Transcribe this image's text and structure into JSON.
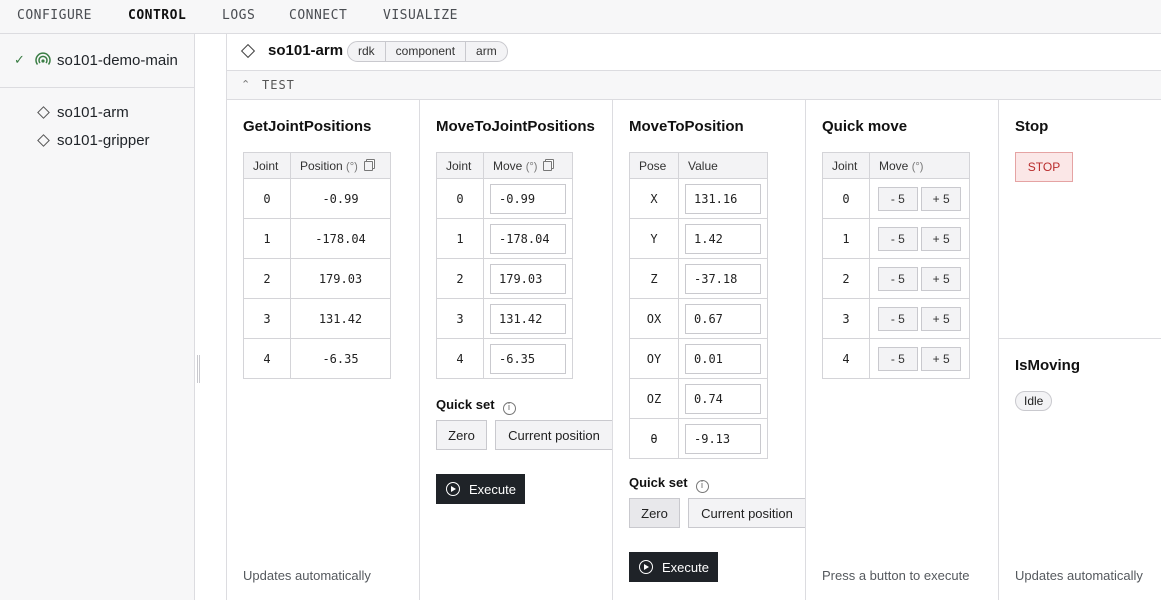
{
  "nav": {
    "tabs": [
      {
        "label": "CONFIGURE"
      },
      {
        "label": "CONTROL"
      },
      {
        "label": "LOGS"
      },
      {
        "label": "CONNECT"
      },
      {
        "label": "VISUALIZE"
      }
    ]
  },
  "sidebar": {
    "machine": {
      "name": "so101-demo-main",
      "status_icon": "checkmark-icon",
      "online_icon": "online-signal-icon"
    },
    "items": [
      {
        "label": "so101-arm"
      },
      {
        "label": "so101-gripper"
      }
    ]
  },
  "card": {
    "title": "so101-arm",
    "breadcrumbs": [
      "rdk",
      "component",
      "arm"
    ],
    "section": "TEST"
  },
  "get_joint_positions": {
    "title": "GetJointPositions",
    "headers": {
      "joint": "Joint",
      "position": "Position",
      "unit": "(°)"
    },
    "rows": [
      {
        "joint": "0",
        "value": "-0.99"
      },
      {
        "joint": "1",
        "value": "-178.04"
      },
      {
        "joint": "2",
        "value": "179.03"
      },
      {
        "joint": "3",
        "value": "131.42"
      },
      {
        "joint": "4",
        "value": "-6.35"
      }
    ],
    "footer": "Updates automatically"
  },
  "move_to_joint_positions": {
    "title": "MoveToJointPositions",
    "headers": {
      "joint": "Joint",
      "move": "Move",
      "unit": "(°)"
    },
    "rows": [
      {
        "joint": "0",
        "value": "-0.99"
      },
      {
        "joint": "1",
        "value": "-178.04"
      },
      {
        "joint": "2",
        "value": "179.03"
      },
      {
        "joint": "3",
        "value": "131.42"
      },
      {
        "joint": "4",
        "value": "-6.35"
      }
    ],
    "quick_set": "Quick set",
    "zero": "Zero",
    "current": "Current position",
    "execute": "Execute"
  },
  "move_to_position": {
    "title": "MoveToPosition",
    "headers": {
      "pose": "Pose",
      "value": "Value"
    },
    "rows": [
      {
        "pose": "X",
        "value": "131.16"
      },
      {
        "pose": "Y",
        "value": "1.42"
      },
      {
        "pose": "Z",
        "value": "-37.18"
      },
      {
        "pose": "OX",
        "value": "0.67"
      },
      {
        "pose": "OY",
        "value": "0.01"
      },
      {
        "pose": "OZ",
        "value": "0.74"
      },
      {
        "pose": "θ",
        "value": "-9.13"
      }
    ],
    "quick_set": "Quick set",
    "zero": "Zero",
    "current": "Current position",
    "execute": "Execute"
  },
  "quick_move": {
    "title": "Quick move",
    "headers": {
      "joint": "Joint",
      "move": "Move",
      "unit": "(°)"
    },
    "rows": [
      {
        "joint": "0",
        "minus": "- 5",
        "plus": "+ 5"
      },
      {
        "joint": "1",
        "minus": "- 5",
        "plus": "+ 5"
      },
      {
        "joint": "2",
        "minus": "- 5",
        "plus": "+ 5"
      },
      {
        "joint": "3",
        "minus": "- 5",
        "plus": "+ 5"
      },
      {
        "joint": "4",
        "minus": "- 5",
        "plus": "+ 5"
      }
    ],
    "footer": "Press a button to execute"
  },
  "stop": {
    "title": "Stop",
    "button": "STOP"
  },
  "is_moving": {
    "title": "IsMoving",
    "status": "Idle",
    "footer": "Updates automatically"
  },
  "colors": {
    "accent_dark": "#1f2328",
    "stop_red": "#b92c2c",
    "online_green": "#3a7d44"
  }
}
